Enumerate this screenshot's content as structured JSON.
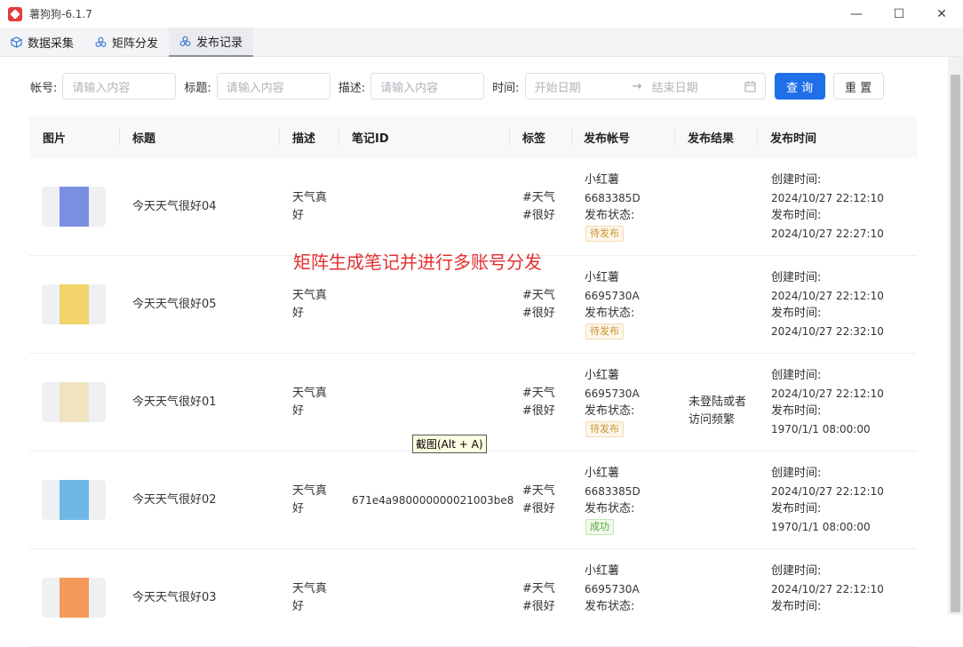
{
  "window": {
    "title": "薯狗狗-6.1.7",
    "minimize": "—",
    "maximize": "☐",
    "close": "✕"
  },
  "tabs": [
    {
      "label": "数据采集",
      "icon": "cube-icon"
    },
    {
      "label": "矩阵分发",
      "icon": "cluster-icon"
    },
    {
      "label": "发布记录",
      "icon": "cluster-icon"
    }
  ],
  "filter": {
    "account_label": "帐号:",
    "account_placeholder": "请输入内容",
    "title_label": "标题:",
    "title_placeholder": "请输入内容",
    "desc_label": "描述:",
    "desc_placeholder": "请输入内容",
    "time_label": "时间:",
    "start_placeholder": "开始日期",
    "range_arrow": "→",
    "end_placeholder": "结束日期",
    "query_button": "查 询",
    "reset_button": "重 置"
  },
  "table": {
    "headers": [
      "图片",
      "标题",
      "描述",
      "笔记ID",
      "标签",
      "发布帐号",
      "发布结果",
      "发布时间"
    ],
    "rows": [
      {
        "title": "今天天气很好04",
        "desc1": "天气真",
        "desc2": "好",
        "note_id": "",
        "tag1": "#天气",
        "tag2": "#很好",
        "platform": "小红薯",
        "account": "6683385D",
        "status_label": "发布状态:",
        "status": "待发布",
        "status_type": "pending",
        "result1": "",
        "result2": "",
        "created_label": "创建时间:",
        "created": "2024/10/27 22:12:10",
        "published_label": "发布时间:",
        "published": "2024/10/27 22:27:10",
        "thumb_color": "#7b8fe0"
      },
      {
        "title": "今天天气很好05",
        "desc1": "天气真",
        "desc2": "好",
        "note_id": "",
        "tag1": "#天气",
        "tag2": "#很好",
        "platform": "小红薯",
        "account": "6695730A",
        "status_label": "发布状态:",
        "status": "待发布",
        "status_type": "pending",
        "result1": "",
        "result2": "",
        "created_label": "创建时间:",
        "created": "2024/10/27 22:12:10",
        "published_label": "发布时间:",
        "published": "2024/10/27 22:32:10",
        "thumb_color": "#f2d36a"
      },
      {
        "title": "今天天气很好01",
        "desc1": "天气真",
        "desc2": "好",
        "note_id": "",
        "tag1": "#天气",
        "tag2": "#很好",
        "platform": "小红薯",
        "account": "6695730A",
        "status_label": "发布状态:",
        "status": "待发布",
        "status_type": "pending",
        "result1": "未登陆或者",
        "result2": "访问频繁",
        "created_label": "创建时间:",
        "created": "2024/10/27 22:12:10",
        "published_label": "发布时间:",
        "published": "1970/1/1 08:00:00",
        "thumb_color": "#efe3c2"
      },
      {
        "title": "今天天气很好02",
        "desc1": "天气真",
        "desc2": "好",
        "note_id": "671e4a980000000021003be8",
        "tag1": "#天气",
        "tag2": "#很好",
        "platform": "小红薯",
        "account": "6683385D",
        "status_label": "发布状态:",
        "status": "成功",
        "status_type": "success",
        "result1": "",
        "result2": "",
        "created_label": "创建时间:",
        "created": "2024/10/27 22:12:10",
        "published_label": "发布时间:",
        "published": "1970/1/1 08:00:00",
        "thumb_color": "#6fb8e6"
      },
      {
        "title": "今天天气很好03",
        "desc1": "天气真",
        "desc2": "好",
        "note_id": "",
        "tag1": "#天气",
        "tag2": "#很好",
        "platform": "小红薯",
        "account": "6695730A",
        "status_label": "发布状态:",
        "status": "",
        "status_type": "pending",
        "result1": "",
        "result2": "",
        "created_label": "创建时间:",
        "created": "2024/10/27 22:12:10",
        "published_label": "发布时间:",
        "published": "",
        "thumb_color": "#f49a5a"
      }
    ]
  },
  "overlay": {
    "annotation": "矩阵生成笔记并进行多账号分发",
    "tooltip": "截图(Alt + A)"
  }
}
